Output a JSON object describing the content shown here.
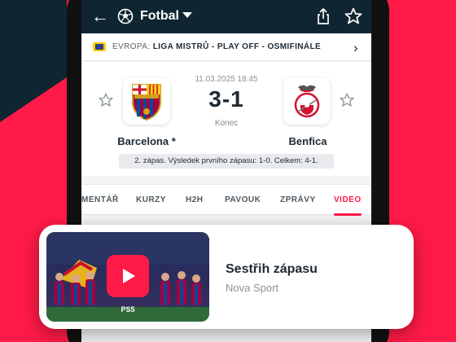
{
  "topbar": {
    "sport": "Fotbal",
    "back_icon": "arrow-left-icon",
    "sport_icon": "soccer-ball-icon",
    "share_icon": "share-icon",
    "favorite_icon": "star-outline-icon"
  },
  "league": {
    "country": "EVROPA: ",
    "competition": "LIGA MISTRŮ - PLAY OFF - OSMIFINÁLE"
  },
  "match": {
    "date": "11.03.2025 18:45",
    "score": "3-1",
    "status": "Konec",
    "home": "Barcelona *",
    "away": "Benfica",
    "info": "2. zápas. Výsledek prvního zápasu: 1-0. Celkem: 4-1."
  },
  "tabs": [
    "MENTÁŘ",
    "KURZY",
    "H2H",
    "PAVOUK",
    "ZPRÁVY",
    "VIDEO"
  ],
  "active_tab": "VIDEO",
  "video": {
    "title": "Sestřih zápasu",
    "source": "Nova Sport"
  },
  "colors": {
    "accent": "#ff1a47",
    "header": "#0f2532",
    "text": "#1e2a33"
  }
}
